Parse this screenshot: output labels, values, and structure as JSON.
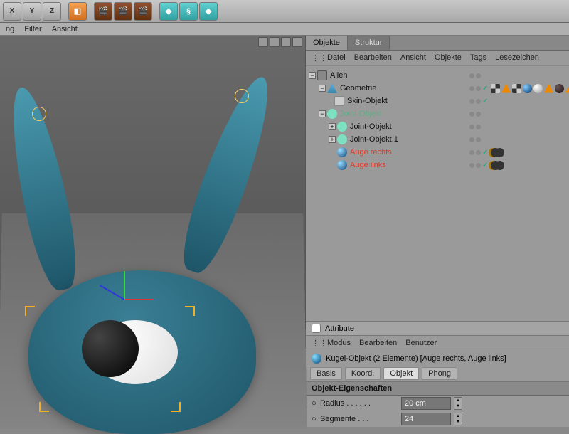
{
  "toolbar": {
    "axis_x": "X",
    "axis_y": "Y",
    "axis_z": "Z"
  },
  "menubar": {
    "item1": "ng",
    "filter": "Filter",
    "ansicht": "Ansicht"
  },
  "tabs": {
    "objekte": "Objekte",
    "struktur": "Struktur"
  },
  "panel_menu": {
    "datei": "Datei",
    "bearbeiten": "Bearbeiten",
    "ansicht": "Ansicht",
    "objekte": "Objekte",
    "tags": "Tags",
    "lesezeichen": "Lesezeichen"
  },
  "tree": {
    "alien": "Alien",
    "geometrie": "Geometrie",
    "skin": "Skin-Objekt",
    "joint_root": "Joint-Objekt",
    "joint1": "Joint-Objekt",
    "joint2": "Joint-Objekt.1",
    "auge_r": "Auge rechts",
    "auge_l": "Auge links"
  },
  "attributes": {
    "header": "Attribute",
    "menu": {
      "modus": "Modus",
      "bearbeiten": "Bearbeiten",
      "benutzer": "Benutzer"
    },
    "object_line": "Kugel-Objekt (2 Elemente) [Auge rechts, Auge links]",
    "tabs": {
      "basis": "Basis",
      "koord": "Koord.",
      "objekt": "Objekt",
      "phong": "Phong"
    },
    "section": "Objekt-Eigenschaften",
    "radius_label": "Radius . . . . . .",
    "radius_val": "20 cm",
    "segmente_label": "Segmente . . .",
    "segmente_val": "24"
  }
}
